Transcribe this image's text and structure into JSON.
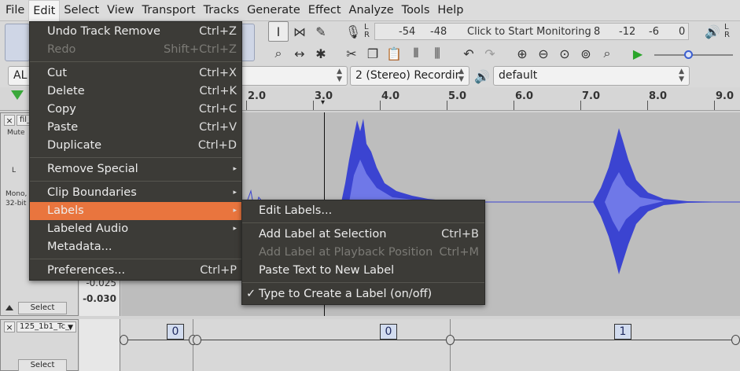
{
  "menubar": {
    "items": [
      "File",
      "Edit",
      "Select",
      "View",
      "Transport",
      "Tracks",
      "Generate",
      "Effect",
      "Analyze",
      "Tools",
      "Help"
    ]
  },
  "meter": {
    "scale_top": [
      "-54",
      "-48",
      "Click to Start Monitoring",
      "-12",
      "-6",
      "0"
    ],
    "scale_top_b": "8"
  },
  "device_bar": {
    "host_partial": "AL",
    "channels": "2 (Stereo) Recordir",
    "output": "default"
  },
  "ruler": {
    "labels": [
      "2.0",
      "3.0",
      "4.0",
      "5.0",
      "6.0",
      "7.0",
      "8.0",
      "9.0"
    ]
  },
  "audio_track": {
    "name": "fil_",
    "mute": "Mute",
    "l": "L",
    "info1": "Mono,",
    "info2": "32-bit",
    "scale": [
      "-0.025",
      "-0.030"
    ],
    "select": "Select"
  },
  "label_track": {
    "name": "125_1b1_Tc_",
    "select": "Select",
    "labels": [
      "0",
      "0",
      "1"
    ]
  },
  "edit_menu": {
    "items": [
      {
        "label": "Undo Track Remove",
        "accel": "Ctrl+Z",
        "enabled": true
      },
      {
        "label": "Redo",
        "accel": "Shift+Ctrl+Z",
        "enabled": false
      },
      {
        "label": "Cut",
        "accel": "Ctrl+X",
        "enabled": true
      },
      {
        "label": "Delete",
        "accel": "Ctrl+K",
        "enabled": true
      },
      {
        "label": "Copy",
        "accel": "Ctrl+C",
        "enabled": true
      },
      {
        "label": "Paste",
        "accel": "Ctrl+V",
        "enabled": true
      },
      {
        "label": "Duplicate",
        "accel": "Ctrl+D",
        "enabled": true
      },
      {
        "label": "Remove Special",
        "accel": "",
        "enabled": true,
        "submenu": true
      },
      {
        "label": "Clip Boundaries",
        "accel": "",
        "enabled": true,
        "submenu": true
      },
      {
        "label": "Labels",
        "accel": "",
        "enabled": true,
        "submenu": true,
        "highlighted": true
      },
      {
        "label": "Labeled Audio",
        "accel": "",
        "enabled": true,
        "submenu": true
      },
      {
        "label": "Metadata...",
        "accel": "",
        "enabled": true
      },
      {
        "label": "Preferences...",
        "accel": "Ctrl+P",
        "enabled": true
      }
    ]
  },
  "labels_submenu": {
    "items": [
      {
        "label": "Edit Labels...",
        "accel": "",
        "enabled": true
      },
      {
        "label": "Add Label at Selection",
        "accel": "Ctrl+B",
        "enabled": true
      },
      {
        "label": "Add Label at Playback Position",
        "accel": "Ctrl+M",
        "enabled": false
      },
      {
        "label": "Paste Text to New Label",
        "accel": "",
        "enabled": true
      },
      {
        "label": "Type to Create a Label (on/off)",
        "accel": "",
        "enabled": true,
        "checked": true
      }
    ]
  },
  "colors": {
    "menu_bg": "#3c3b37",
    "menu_highlight": "#e9753e",
    "waveform": "#3b44d1",
    "waveform_rms": "#6f78e8",
    "track_bg": "#bdbdbd"
  }
}
